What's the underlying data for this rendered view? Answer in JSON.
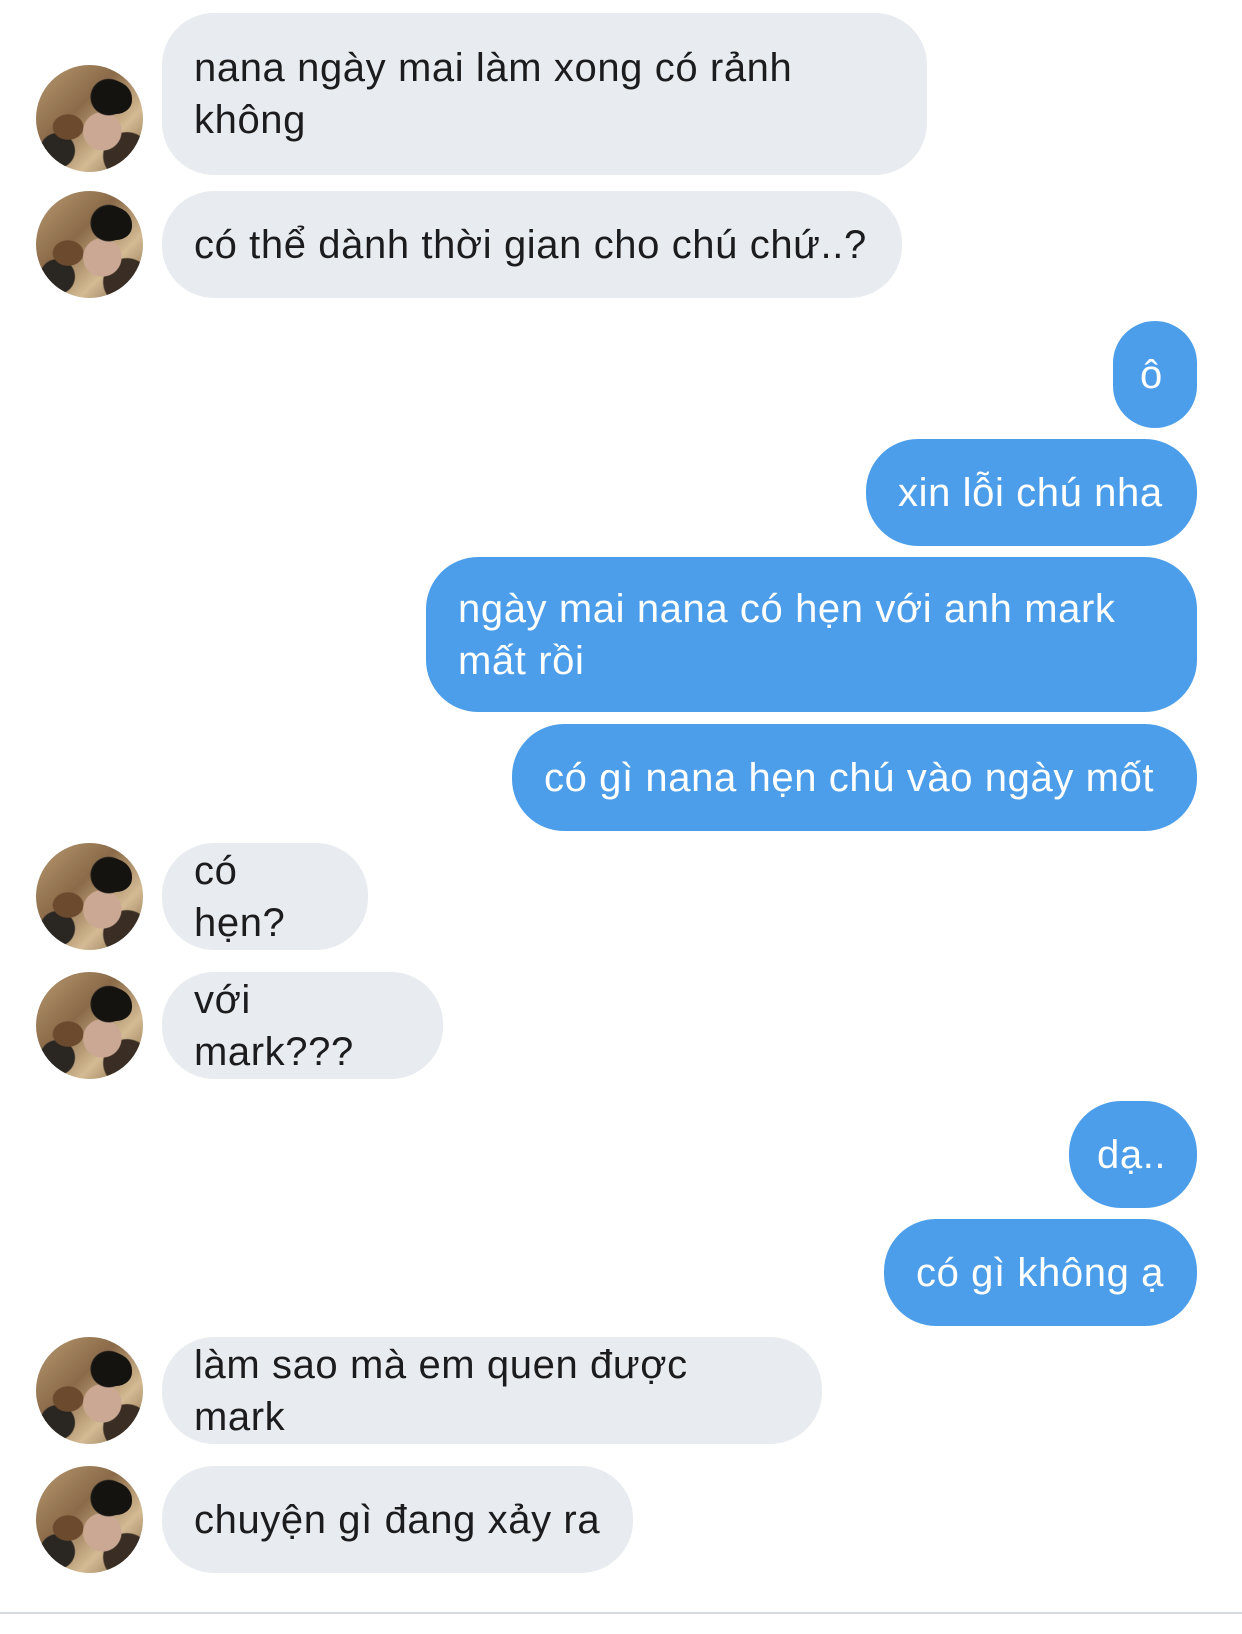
{
  "conversation": {
    "messages": [
      {
        "sender": "other",
        "text": "nana ngày mai làm xong có rảnh\nkhông"
      },
      {
        "sender": "other",
        "text": "có thể dành thời gian cho chú chứ..?"
      },
      {
        "sender": "me",
        "text": "ô"
      },
      {
        "sender": "me",
        "text": "xin lỗi chú nha"
      },
      {
        "sender": "me",
        "text": "ngày mai nana có hẹn với anh mark\nmất rồi"
      },
      {
        "sender": "me",
        "text": "có gì nana hẹn chú vào ngày mốt"
      },
      {
        "sender": "other",
        "text": "có hẹn?"
      },
      {
        "sender": "other",
        "text": "với mark???"
      },
      {
        "sender": "me",
        "text": "dạ.."
      },
      {
        "sender": "me",
        "text": "có gì không ạ"
      },
      {
        "sender": "other",
        "text": "làm sao mà em quen được mark"
      },
      {
        "sender": "other",
        "text": "chuyện gì đang xảy ra"
      }
    ]
  },
  "colors": {
    "incoming_bubble": "#e8ebef",
    "outgoing_bubble": "#4c9eea",
    "incoming_text": "#1c1c1e",
    "outgoing_text": "#ffffff"
  }
}
